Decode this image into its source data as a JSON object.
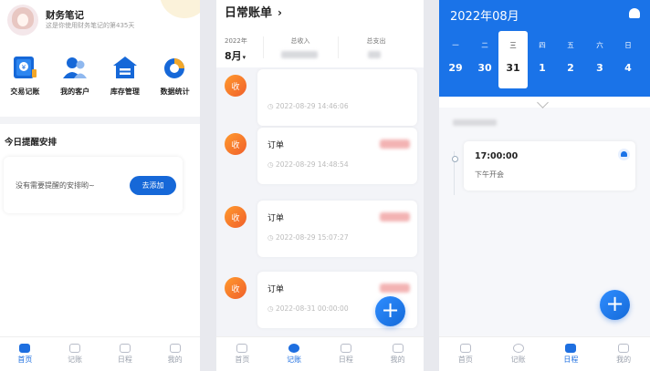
{
  "home": {
    "app_name": "财务笔记",
    "welcome": "这是你使用财务笔记的第435天",
    "features": [
      {
        "label": "交易记账",
        "icon": "transaction-book-icon"
      },
      {
        "label": "我的客户",
        "icon": "customers-icon"
      },
      {
        "label": "库存管理",
        "icon": "warehouse-icon"
      },
      {
        "label": "数据统计",
        "icon": "pie-chart-icon"
      }
    ],
    "reminder_title": "今日提醒安排",
    "empty_text": "没有需要提醒的安排哟~",
    "add_button": "去添加"
  },
  "ledger": {
    "title": "日常账单",
    "year": "2022年",
    "month": "8月",
    "income_label": "总收入",
    "expense_label": "总支出",
    "badge": "收",
    "records": [
      {
        "title": "",
        "time": "2022-08-29 14:46:06"
      },
      {
        "title": "订单",
        "time": "2022-08-29 14:48:54"
      },
      {
        "title": "订单",
        "time": "2022-08-29 15:07:27"
      },
      {
        "title": "订单",
        "time": "2022-08-31 00:00:00"
      }
    ],
    "fab": "+"
  },
  "schedule": {
    "title": "2022年08月",
    "weekdays": [
      "一",
      "二",
      "三",
      "四",
      "五",
      "六",
      "日"
    ],
    "days": [
      "29",
      "30",
      "31",
      "1",
      "2",
      "3",
      "4"
    ],
    "selected_index": 2,
    "event": {
      "time": "17:00:00",
      "desc": "下午开会"
    },
    "fab": "+"
  },
  "tabs": [
    "首页",
    "记账",
    "日程",
    "我的"
  ],
  "colors": {
    "primary": "#1a73e8",
    "badge": "#f26b2c",
    "text": "#222222"
  }
}
